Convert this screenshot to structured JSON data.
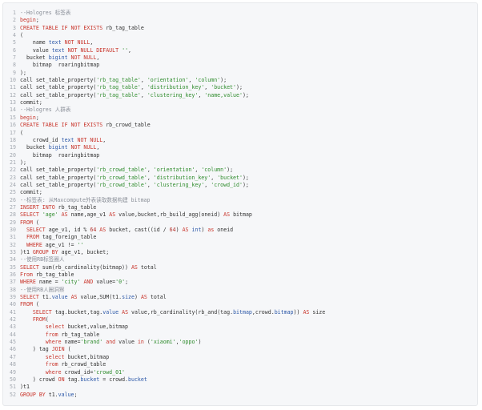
{
  "colors": {
    "background": "#f6f7f9",
    "line_number": "#a3a8b0",
    "plain": "#333333",
    "keyword": "#c9352b",
    "string": "#2f8c2d",
    "comment": "#8a8f98",
    "type": "#2c58a8",
    "number": "#b3312b"
  },
  "code": {
    "lines": [
      {
        "n": "1",
        "tokens": [
          [
            "cm",
            "--Hologres 标签表"
          ]
        ]
      },
      {
        "n": "2",
        "tokens": [
          [
            "kw",
            "begin"
          ],
          [
            "plain",
            ";"
          ]
        ]
      },
      {
        "n": "3",
        "tokens": [
          [
            "kw",
            "CREATE TABLE IF NOT EXISTS"
          ],
          [
            "plain",
            " rb_tag_table"
          ]
        ]
      },
      {
        "n": "4",
        "tokens": [
          [
            "plain",
            "("
          ]
        ]
      },
      {
        "n": "5",
        "tokens": [
          [
            "plain",
            "    name "
          ],
          [
            "ty",
            "text"
          ],
          [
            "plain",
            " "
          ],
          [
            "kw",
            "NOT NULL"
          ],
          [
            "plain",
            ","
          ]
        ]
      },
      {
        "n": "6",
        "tokens": [
          [
            "plain",
            "    value "
          ],
          [
            "ty",
            "text"
          ],
          [
            "plain",
            " "
          ],
          [
            "kw",
            "NOT NULL DEFAULT"
          ],
          [
            "plain",
            " "
          ],
          [
            "str",
            "''"
          ],
          [
            "plain",
            ","
          ]
        ]
      },
      {
        "n": "7",
        "tokens": [
          [
            "plain",
            "  bucket "
          ],
          [
            "ty",
            "bigint"
          ],
          [
            "plain",
            " "
          ],
          [
            "kw",
            "NOT NULL"
          ],
          [
            "plain",
            ","
          ]
        ]
      },
      {
        "n": "8",
        "tokens": [
          [
            "plain",
            "    bitmap  roaringbitmap"
          ]
        ]
      },
      {
        "n": "9",
        "tokens": [
          [
            "plain",
            ");"
          ]
        ]
      },
      {
        "n": "10",
        "tokens": [
          [
            "plain",
            "call set_table_property("
          ],
          [
            "str",
            "'rb_tag_table'"
          ],
          [
            "plain",
            ", "
          ],
          [
            "str",
            "'orientation'"
          ],
          [
            "plain",
            ", "
          ],
          [
            "str",
            "'column'"
          ],
          [
            "plain",
            ");"
          ]
        ]
      },
      {
        "n": "11",
        "tokens": [
          [
            "plain",
            "call set_table_property("
          ],
          [
            "str",
            "'rb_tag_table'"
          ],
          [
            "plain",
            ", "
          ],
          [
            "str",
            "'distribution_key'"
          ],
          [
            "plain",
            ", "
          ],
          [
            "str",
            "'bucket'"
          ],
          [
            "plain",
            ");"
          ]
        ]
      },
      {
        "n": "12",
        "tokens": [
          [
            "plain",
            "call set_table_property("
          ],
          [
            "str",
            "'rb_tag_table'"
          ],
          [
            "plain",
            ", "
          ],
          [
            "str",
            "'clustering_key'"
          ],
          [
            "plain",
            ", "
          ],
          [
            "str",
            "'name,value'"
          ],
          [
            "plain",
            ");"
          ]
        ]
      },
      {
        "n": "13",
        "tokens": [
          [
            "plain",
            "commit;"
          ]
        ]
      },
      {
        "n": "14",
        "tokens": [
          [
            "cm",
            "--Hologres 人群表"
          ]
        ]
      },
      {
        "n": "15",
        "tokens": [
          [
            "kw",
            "begin"
          ],
          [
            "plain",
            ";"
          ]
        ]
      },
      {
        "n": "16",
        "tokens": [
          [
            "kw",
            "CREATE TABLE IF NOT EXISTS"
          ],
          [
            "plain",
            " rb_crowd_table"
          ]
        ]
      },
      {
        "n": "17",
        "tokens": [
          [
            "plain",
            "("
          ]
        ]
      },
      {
        "n": "18",
        "tokens": [
          [
            "plain",
            "    crowd_id "
          ],
          [
            "ty",
            "text"
          ],
          [
            "plain",
            " "
          ],
          [
            "kw",
            "NOT NULL"
          ],
          [
            "plain",
            ","
          ]
        ]
      },
      {
        "n": "19",
        "tokens": [
          [
            "plain",
            "  bucket "
          ],
          [
            "ty",
            "bigint"
          ],
          [
            "plain",
            " "
          ],
          [
            "kw",
            "NOT NULL"
          ],
          [
            "plain",
            ","
          ]
        ]
      },
      {
        "n": "20",
        "tokens": [
          [
            "plain",
            "    bitmap  roaringbitmap"
          ]
        ]
      },
      {
        "n": "21",
        "tokens": [
          [
            "plain",
            ");"
          ]
        ]
      },
      {
        "n": "22",
        "tokens": [
          [
            "plain",
            "call set_table_property("
          ],
          [
            "str",
            "'rb_crowd_table'"
          ],
          [
            "plain",
            ", "
          ],
          [
            "str",
            "'orientation'"
          ],
          [
            "plain",
            ", "
          ],
          [
            "str",
            "'column'"
          ],
          [
            "plain",
            ");"
          ]
        ]
      },
      {
        "n": "23",
        "tokens": [
          [
            "plain",
            "call set_table_property("
          ],
          [
            "str",
            "'rb_crowd_table'"
          ],
          [
            "plain",
            ", "
          ],
          [
            "str",
            "'distribution_key'"
          ],
          [
            "plain",
            ", "
          ],
          [
            "str",
            "'bucket'"
          ],
          [
            "plain",
            ");"
          ]
        ]
      },
      {
        "n": "24",
        "tokens": [
          [
            "plain",
            "call set_table_property("
          ],
          [
            "str",
            "'rb_crowd_table'"
          ],
          [
            "plain",
            ", "
          ],
          [
            "str",
            "'clustering_key'"
          ],
          [
            "plain",
            ", "
          ],
          [
            "str",
            "'crowd_id'"
          ],
          [
            "plain",
            ");"
          ]
        ]
      },
      {
        "n": "25",
        "tokens": [
          [
            "plain",
            "commit;"
          ]
        ]
      },
      {
        "n": "26",
        "tokens": [
          [
            "cm",
            "--标签表: 从Maxcompute外表读取数据构建 bitmap"
          ]
        ]
      },
      {
        "n": "27",
        "tokens": [
          [
            "kw",
            "INSERT INTO"
          ],
          [
            "plain",
            " rb_tag_table"
          ]
        ]
      },
      {
        "n": "28",
        "tokens": [
          [
            "kw",
            "SELECT"
          ],
          [
            "plain",
            " "
          ],
          [
            "str",
            "'age'"
          ],
          [
            "plain",
            " "
          ],
          [
            "kw",
            "AS"
          ],
          [
            "plain",
            " name,age_v1 "
          ],
          [
            "kw",
            "AS"
          ],
          [
            "plain",
            " value,bucket,rb_build_agg(oneid) "
          ],
          [
            "kw",
            "AS"
          ],
          [
            "plain",
            " bitmap"
          ]
        ]
      },
      {
        "n": "29",
        "tokens": [
          [
            "kw",
            "FROM"
          ],
          [
            "plain",
            " ("
          ]
        ]
      },
      {
        "n": "30",
        "tokens": [
          [
            "plain",
            "  "
          ],
          [
            "kw",
            "SELECT"
          ],
          [
            "plain",
            " age_v1, id % "
          ],
          [
            "num",
            "64"
          ],
          [
            "plain",
            " "
          ],
          [
            "kw",
            "AS"
          ],
          [
            "plain",
            " bucket, cast((id / "
          ],
          [
            "num",
            "64"
          ],
          [
            "plain",
            ") "
          ],
          [
            "kw",
            "AS"
          ],
          [
            "plain",
            " "
          ],
          [
            "ty",
            "int"
          ],
          [
            "plain",
            ") "
          ],
          [
            "kw",
            "as"
          ],
          [
            "plain",
            " oneid"
          ]
        ]
      },
      {
        "n": "31",
        "tokens": [
          [
            "plain",
            "  "
          ],
          [
            "kw",
            "FROM"
          ],
          [
            "plain",
            " tag_foreign_table"
          ]
        ]
      },
      {
        "n": "32",
        "tokens": [
          [
            "plain",
            "  "
          ],
          [
            "kw",
            "WHERE"
          ],
          [
            "plain",
            " age_v1 != "
          ],
          [
            "str",
            "''"
          ]
        ]
      },
      {
        "n": "33",
        "tokens": [
          [
            "plain",
            ")t1 "
          ],
          [
            "kw",
            "GROUP BY"
          ],
          [
            "plain",
            " age_v1, bucket;"
          ]
        ]
      },
      {
        "n": "34",
        "tokens": [
          [
            "cm",
            "--使用RB标签圈人"
          ]
        ]
      },
      {
        "n": "35",
        "tokens": [
          [
            "kw",
            "SELECT"
          ],
          [
            "plain",
            " sum(rb_cardinality(bitmap)) "
          ],
          [
            "kw",
            "AS"
          ],
          [
            "plain",
            " total"
          ]
        ]
      },
      {
        "n": "36",
        "tokens": [
          [
            "kw",
            "From"
          ],
          [
            "plain",
            " rb_tag_table"
          ]
        ]
      },
      {
        "n": "37",
        "tokens": [
          [
            "kw",
            "WHERE"
          ],
          [
            "plain",
            " name = "
          ],
          [
            "str",
            "'city'"
          ],
          [
            "plain",
            " "
          ],
          [
            "kw",
            "AND"
          ],
          [
            "plain",
            " value="
          ],
          [
            "str",
            "'0'"
          ],
          [
            "plain",
            ";"
          ]
        ]
      },
      {
        "n": "38",
        "tokens": [
          [
            "cm",
            "--使用RB人圈洞察"
          ]
        ]
      },
      {
        "n": "39",
        "tokens": [
          [
            "kw",
            "SELECT"
          ],
          [
            "plain",
            " t1."
          ],
          [
            "ty",
            "value"
          ],
          [
            "plain",
            " "
          ],
          [
            "kw",
            "AS"
          ],
          [
            "plain",
            " value,SUM(t1."
          ],
          [
            "ty",
            "size"
          ],
          [
            "plain",
            ") "
          ],
          [
            "kw",
            "AS"
          ],
          [
            "plain",
            " total"
          ]
        ]
      },
      {
        "n": "40",
        "tokens": [
          [
            "kw",
            "FROM"
          ],
          [
            "plain",
            " ("
          ]
        ]
      },
      {
        "n": "41",
        "tokens": [
          [
            "plain",
            "    "
          ],
          [
            "kw",
            "SELECT"
          ],
          [
            "plain",
            " tag.bucket,tag."
          ],
          [
            "ty",
            "value"
          ],
          [
            "plain",
            " "
          ],
          [
            "kw",
            "AS"
          ],
          [
            "plain",
            " value,rb_cardinality(rb_and(tag."
          ],
          [
            "ty",
            "bitmap"
          ],
          [
            "plain",
            ",crowd."
          ],
          [
            "ty",
            "bitmap"
          ],
          [
            "plain",
            ")) "
          ],
          [
            "kw",
            "AS"
          ],
          [
            "plain",
            " size"
          ]
        ]
      },
      {
        "n": "42",
        "tokens": [
          [
            "plain",
            "    "
          ],
          [
            "kw",
            "FROM"
          ],
          [
            "plain",
            "("
          ]
        ]
      },
      {
        "n": "43",
        "tokens": [
          [
            "plain",
            "        "
          ],
          [
            "kw",
            "select"
          ],
          [
            "plain",
            " bucket,value,bitmap"
          ]
        ]
      },
      {
        "n": "44",
        "tokens": [
          [
            "plain",
            "        "
          ],
          [
            "kw",
            "from"
          ],
          [
            "plain",
            " rb_tag_table"
          ]
        ]
      },
      {
        "n": "45",
        "tokens": [
          [
            "plain",
            "        "
          ],
          [
            "kw",
            "where"
          ],
          [
            "plain",
            " name="
          ],
          [
            "str",
            "'brand'"
          ],
          [
            "plain",
            " "
          ],
          [
            "kw",
            "and"
          ],
          [
            "plain",
            " value "
          ],
          [
            "kw",
            "in"
          ],
          [
            "plain",
            " ("
          ],
          [
            "str",
            "'xiaomi'"
          ],
          [
            "plain",
            ","
          ],
          [
            "str",
            "'oppo'"
          ],
          [
            "plain",
            ")"
          ]
        ]
      },
      {
        "n": "46",
        "tokens": [
          [
            "plain",
            "    ) tag "
          ],
          [
            "kw",
            "JOIN"
          ],
          [
            "plain",
            " ("
          ]
        ]
      },
      {
        "n": "47",
        "tokens": [
          [
            "plain",
            "        "
          ],
          [
            "kw",
            "select"
          ],
          [
            "plain",
            " bucket,bitmap"
          ]
        ]
      },
      {
        "n": "48",
        "tokens": [
          [
            "plain",
            "        "
          ],
          [
            "kw",
            "from"
          ],
          [
            "plain",
            " rb_crowd_table"
          ]
        ]
      },
      {
        "n": "49",
        "tokens": [
          [
            "plain",
            "        "
          ],
          [
            "kw",
            "where"
          ],
          [
            "plain",
            " crowd_id="
          ],
          [
            "str",
            "'crowd_01'"
          ]
        ]
      },
      {
        "n": "50",
        "tokens": [
          [
            "plain",
            "    ) crowd "
          ],
          [
            "kw",
            "ON"
          ],
          [
            "plain",
            " tag."
          ],
          [
            "ty",
            "bucket"
          ],
          [
            "plain",
            " = crowd."
          ],
          [
            "ty",
            "bucket"
          ]
        ]
      },
      {
        "n": "51",
        "tokens": [
          [
            "plain",
            ")t1"
          ]
        ]
      },
      {
        "n": "52",
        "tokens": [
          [
            "kw",
            "GROUP BY"
          ],
          [
            "plain",
            " t1."
          ],
          [
            "ty",
            "value"
          ],
          [
            "plain",
            ";"
          ]
        ]
      }
    ]
  }
}
